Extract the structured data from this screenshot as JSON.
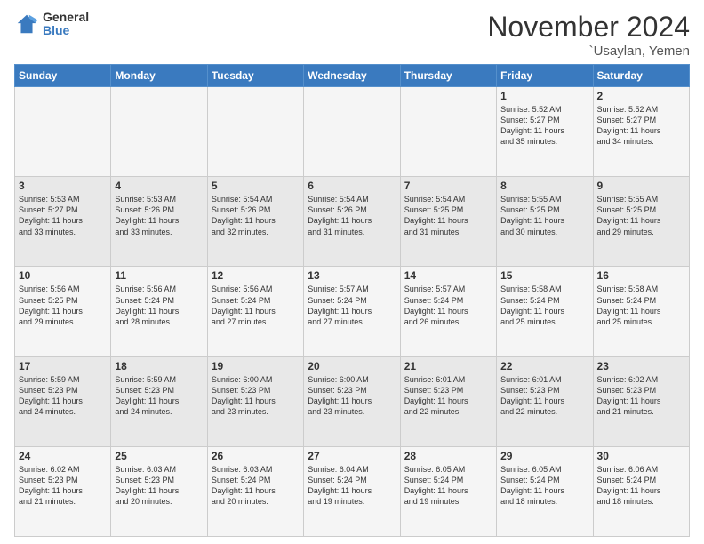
{
  "header": {
    "logo_general": "General",
    "logo_blue": "Blue",
    "month_title": "November 2024",
    "location": "`Usaylan, Yemen"
  },
  "weekdays": [
    "Sunday",
    "Monday",
    "Tuesday",
    "Wednesday",
    "Thursday",
    "Friday",
    "Saturday"
  ],
  "weeks": [
    [
      {
        "day": "",
        "info": ""
      },
      {
        "day": "",
        "info": ""
      },
      {
        "day": "",
        "info": ""
      },
      {
        "day": "",
        "info": ""
      },
      {
        "day": "",
        "info": ""
      },
      {
        "day": "1",
        "info": "Sunrise: 5:52 AM\nSunset: 5:27 PM\nDaylight: 11 hours\nand 35 minutes."
      },
      {
        "day": "2",
        "info": "Sunrise: 5:52 AM\nSunset: 5:27 PM\nDaylight: 11 hours\nand 34 minutes."
      }
    ],
    [
      {
        "day": "3",
        "info": "Sunrise: 5:53 AM\nSunset: 5:27 PM\nDaylight: 11 hours\nand 33 minutes."
      },
      {
        "day": "4",
        "info": "Sunrise: 5:53 AM\nSunset: 5:26 PM\nDaylight: 11 hours\nand 33 minutes."
      },
      {
        "day": "5",
        "info": "Sunrise: 5:54 AM\nSunset: 5:26 PM\nDaylight: 11 hours\nand 32 minutes."
      },
      {
        "day": "6",
        "info": "Sunrise: 5:54 AM\nSunset: 5:26 PM\nDaylight: 11 hours\nand 31 minutes."
      },
      {
        "day": "7",
        "info": "Sunrise: 5:54 AM\nSunset: 5:25 PM\nDaylight: 11 hours\nand 31 minutes."
      },
      {
        "day": "8",
        "info": "Sunrise: 5:55 AM\nSunset: 5:25 PM\nDaylight: 11 hours\nand 30 minutes."
      },
      {
        "day": "9",
        "info": "Sunrise: 5:55 AM\nSunset: 5:25 PM\nDaylight: 11 hours\nand 29 minutes."
      }
    ],
    [
      {
        "day": "10",
        "info": "Sunrise: 5:56 AM\nSunset: 5:25 PM\nDaylight: 11 hours\nand 29 minutes."
      },
      {
        "day": "11",
        "info": "Sunrise: 5:56 AM\nSunset: 5:24 PM\nDaylight: 11 hours\nand 28 minutes."
      },
      {
        "day": "12",
        "info": "Sunrise: 5:56 AM\nSunset: 5:24 PM\nDaylight: 11 hours\nand 27 minutes."
      },
      {
        "day": "13",
        "info": "Sunrise: 5:57 AM\nSunset: 5:24 PM\nDaylight: 11 hours\nand 27 minutes."
      },
      {
        "day": "14",
        "info": "Sunrise: 5:57 AM\nSunset: 5:24 PM\nDaylight: 11 hours\nand 26 minutes."
      },
      {
        "day": "15",
        "info": "Sunrise: 5:58 AM\nSunset: 5:24 PM\nDaylight: 11 hours\nand 25 minutes."
      },
      {
        "day": "16",
        "info": "Sunrise: 5:58 AM\nSunset: 5:24 PM\nDaylight: 11 hours\nand 25 minutes."
      }
    ],
    [
      {
        "day": "17",
        "info": "Sunrise: 5:59 AM\nSunset: 5:23 PM\nDaylight: 11 hours\nand 24 minutes."
      },
      {
        "day": "18",
        "info": "Sunrise: 5:59 AM\nSunset: 5:23 PM\nDaylight: 11 hours\nand 24 minutes."
      },
      {
        "day": "19",
        "info": "Sunrise: 6:00 AM\nSunset: 5:23 PM\nDaylight: 11 hours\nand 23 minutes."
      },
      {
        "day": "20",
        "info": "Sunrise: 6:00 AM\nSunset: 5:23 PM\nDaylight: 11 hours\nand 23 minutes."
      },
      {
        "day": "21",
        "info": "Sunrise: 6:01 AM\nSunset: 5:23 PM\nDaylight: 11 hours\nand 22 minutes."
      },
      {
        "day": "22",
        "info": "Sunrise: 6:01 AM\nSunset: 5:23 PM\nDaylight: 11 hours\nand 22 minutes."
      },
      {
        "day": "23",
        "info": "Sunrise: 6:02 AM\nSunset: 5:23 PM\nDaylight: 11 hours\nand 21 minutes."
      }
    ],
    [
      {
        "day": "24",
        "info": "Sunrise: 6:02 AM\nSunset: 5:23 PM\nDaylight: 11 hours\nand 21 minutes."
      },
      {
        "day": "25",
        "info": "Sunrise: 6:03 AM\nSunset: 5:23 PM\nDaylight: 11 hours\nand 20 minutes."
      },
      {
        "day": "26",
        "info": "Sunrise: 6:03 AM\nSunset: 5:24 PM\nDaylight: 11 hours\nand 20 minutes."
      },
      {
        "day": "27",
        "info": "Sunrise: 6:04 AM\nSunset: 5:24 PM\nDaylight: 11 hours\nand 19 minutes."
      },
      {
        "day": "28",
        "info": "Sunrise: 6:05 AM\nSunset: 5:24 PM\nDaylight: 11 hours\nand 19 minutes."
      },
      {
        "day": "29",
        "info": "Sunrise: 6:05 AM\nSunset: 5:24 PM\nDaylight: 11 hours\nand 18 minutes."
      },
      {
        "day": "30",
        "info": "Sunrise: 6:06 AM\nSunset: 5:24 PM\nDaylight: 11 hours\nand 18 minutes."
      }
    ]
  ]
}
